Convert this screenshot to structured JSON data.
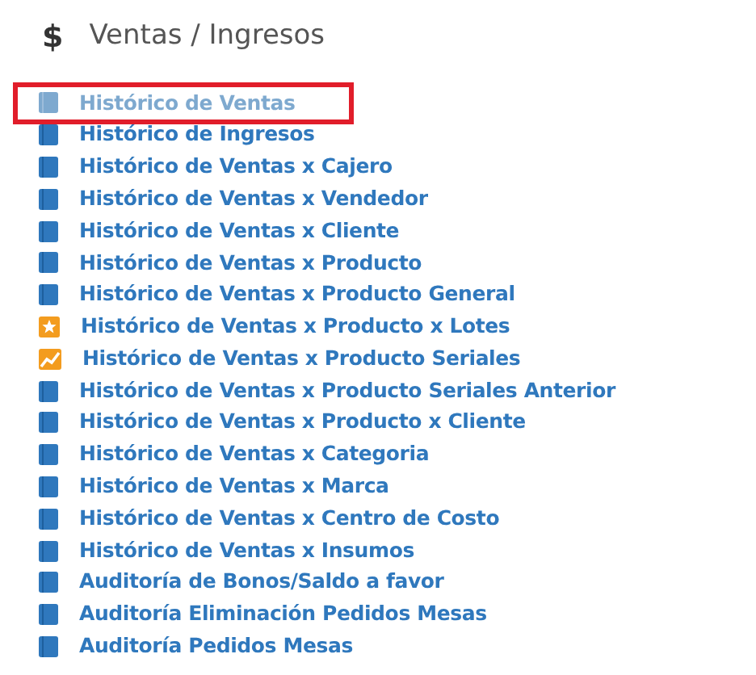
{
  "section": {
    "icon": "$",
    "title": "Ventas / Ingresos"
  },
  "items": [
    {
      "label": "Histórico de Ventas",
      "kind": "book",
      "hovered": true,
      "highlighted": true
    },
    {
      "label": "Histórico de Ingresos",
      "kind": "book",
      "hovered": false,
      "highlighted": false
    },
    {
      "label": "Histórico de Ventas x Cajero",
      "kind": "book",
      "hovered": false,
      "highlighted": false
    },
    {
      "label": "Histórico de Ventas x Vendedor",
      "kind": "book",
      "hovered": false,
      "highlighted": false
    },
    {
      "label": "Histórico de Ventas x Cliente",
      "kind": "book",
      "hovered": false,
      "highlighted": false
    },
    {
      "label": "Histórico de Ventas x Producto",
      "kind": "book",
      "hovered": false,
      "highlighted": false
    },
    {
      "label": "Histórico de Ventas x Producto General",
      "kind": "book",
      "hovered": false,
      "highlighted": false
    },
    {
      "label": "Histórico de Ventas x Producto x Lotes",
      "kind": "star",
      "hovered": false,
      "highlighted": false
    },
    {
      "label": "Histórico de Ventas x Producto Seriales",
      "kind": "chart",
      "hovered": false,
      "highlighted": false
    },
    {
      "label": "Histórico de Ventas x Producto Seriales Anterior",
      "kind": "book",
      "hovered": false,
      "highlighted": false
    },
    {
      "label": "Histórico de Ventas x Producto x Cliente",
      "kind": "book",
      "hovered": false,
      "highlighted": false
    },
    {
      "label": "Histórico de Ventas x Categoria",
      "kind": "book",
      "hovered": false,
      "highlighted": false
    },
    {
      "label": "Histórico de Ventas x Marca",
      "kind": "book",
      "hovered": false,
      "highlighted": false
    },
    {
      "label": "Histórico de Ventas x Centro de Costo",
      "kind": "book",
      "hovered": false,
      "highlighted": false
    },
    {
      "label": "Histórico de Ventas x Insumos",
      "kind": "book",
      "hovered": false,
      "highlighted": false
    },
    {
      "label": "Auditoría de Bonos/Saldo a favor",
      "kind": "book",
      "hovered": false,
      "highlighted": false
    },
    {
      "label": "Auditoría Eliminación Pedidos Mesas",
      "kind": "book",
      "hovered": false,
      "highlighted": false
    },
    {
      "label": "Auditoría Pedidos Mesas",
      "kind": "book",
      "hovered": false,
      "highlighted": false
    }
  ]
}
